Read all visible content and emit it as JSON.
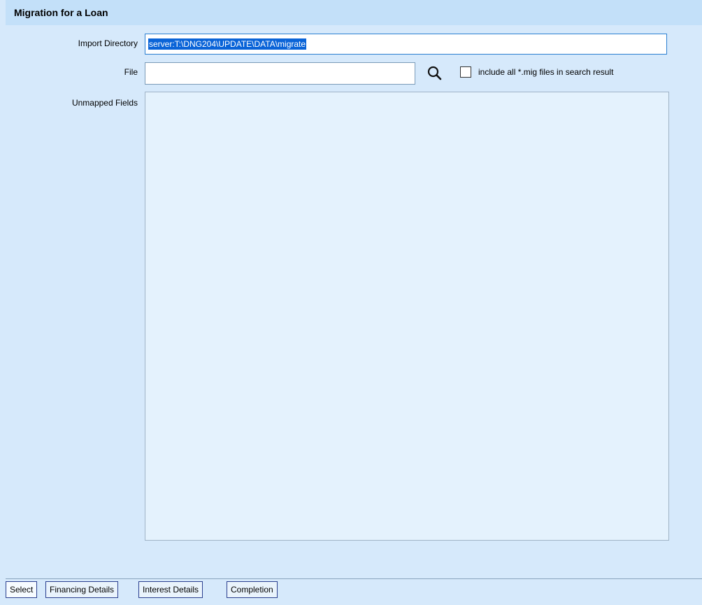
{
  "header": {
    "title": "Migration for a Loan"
  },
  "form": {
    "import_directory_label": "Import Directory",
    "import_directory_value": "server:T:\\DNG204\\UPDATE\\DATA\\migrate",
    "file_label": "File",
    "file_value": "",
    "search_icon": "magnifier-icon",
    "include_all_label": "include all *.mig files in search result",
    "include_all_checked": false,
    "unmapped_fields_label": "Unmapped Fields"
  },
  "tabs": [
    {
      "label": "Select",
      "active": true
    },
    {
      "label": "Financing Details",
      "active": false
    },
    {
      "label": "Interest Details",
      "active": false
    },
    {
      "label": "Completion",
      "active": false
    }
  ],
  "colors": {
    "background": "#d6e9fb",
    "title_bar": "#c3e0f9",
    "selection": "#0a64d8",
    "tab_border": "#2a3f8f"
  }
}
